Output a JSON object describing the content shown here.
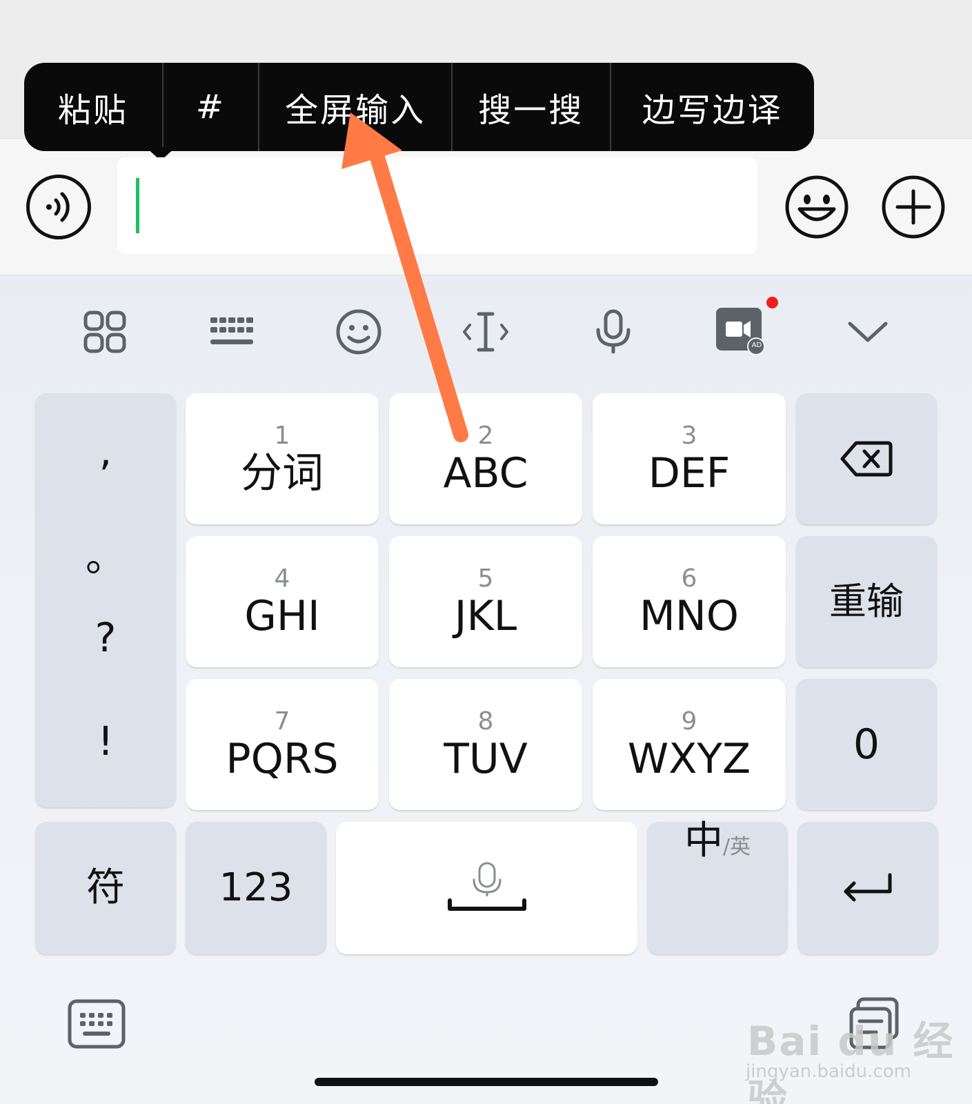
{
  "context_menu": {
    "items": [
      "粘贴",
      "#",
      "全屏输入",
      "搜一搜",
      "边写边译"
    ]
  },
  "input": {
    "value": "",
    "cursor_color": "#1fbf65"
  },
  "input_bar_icons": [
    "voice-icon",
    "emoji-icon",
    "plus-icon"
  ],
  "toolbar": {
    "icons": [
      "grid-icon",
      "keyboard-icon",
      "emoji-icon",
      "text-cursor-icon",
      "microphone-icon",
      "video-ad-icon",
      "chevron-down-icon"
    ],
    "ad_badge": "AD",
    "notification_dot_color": "#f21d1d"
  },
  "keyboard": {
    "punctuation": [
      ",",
      "。",
      "?",
      "!"
    ],
    "number_keys": [
      {
        "num": "1",
        "label": "分词"
      },
      {
        "num": "2",
        "label": "ABC"
      },
      {
        "num": "3",
        "label": "DEF"
      },
      {
        "num": "4",
        "label": "GHI"
      },
      {
        "num": "5",
        "label": "JKL"
      },
      {
        "num": "6",
        "label": "MNO"
      },
      {
        "num": "7",
        "label": "PQRS"
      },
      {
        "num": "8",
        "label": "TUV"
      },
      {
        "num": "9",
        "label": "WXYZ"
      }
    ],
    "reset_label": "重输",
    "zero_label": "0",
    "symbol_label": "符",
    "num_mode_label": "123",
    "lang_main": "中",
    "lang_alt": "/英"
  },
  "annotation": {
    "arrow_color": "#ff7a45"
  },
  "watermark": {
    "logo": "Bai du 经验",
    "url": "jingyan.baidu.com"
  }
}
